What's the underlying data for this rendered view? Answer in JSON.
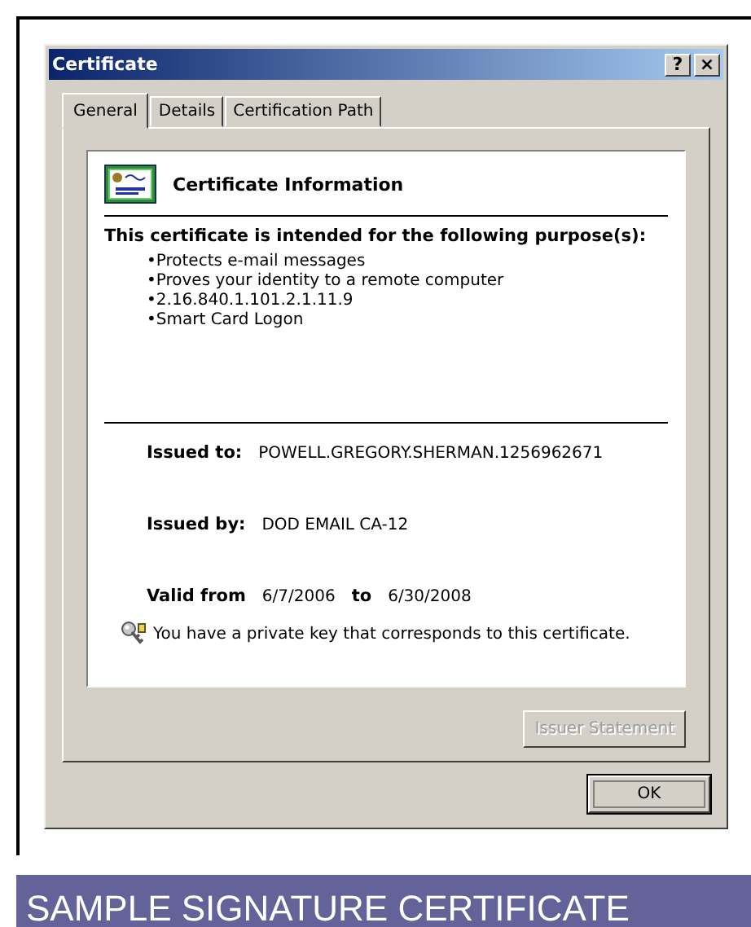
{
  "window": {
    "title": "Certificate",
    "title_buttons": [
      "?",
      "×"
    ]
  },
  "tabs": [
    {
      "label": "General",
      "selected": true
    },
    {
      "label": "Details",
      "selected": false
    },
    {
      "label": "Certification Path",
      "selected": false
    }
  ],
  "info": {
    "heading": "Certificate Information",
    "purpose_title": "This certificate is intended for the following purpose(s):",
    "purposes": [
      "•Protects e-mail messages",
      "•Proves your identity to a remote computer",
      "•2.16.840.1.101.2.1.11.9",
      "•Smart Card Logon"
    ],
    "issued_to_label": "Issued to:",
    "issued_to": "POWELL.GREGORY.SHERMAN.1256962671",
    "issued_by_label": "Issued by:",
    "issued_by": "DOD EMAIL CA-12",
    "valid_from_label": "Valid from",
    "valid_from": "6/7/2006",
    "valid_to_label": "to",
    "valid_to": "6/30/2008",
    "key_note": "You have a private key that corresponds to this certificate."
  },
  "buttons": [
    {
      "label": "Issuer Statement",
      "disabled": true,
      "focused": false
    },
    {
      "label": "OK",
      "disabled": false,
      "focused": true
    }
  ],
  "caption": "SAMPLE SIGNATURE CERTIFICATE"
}
